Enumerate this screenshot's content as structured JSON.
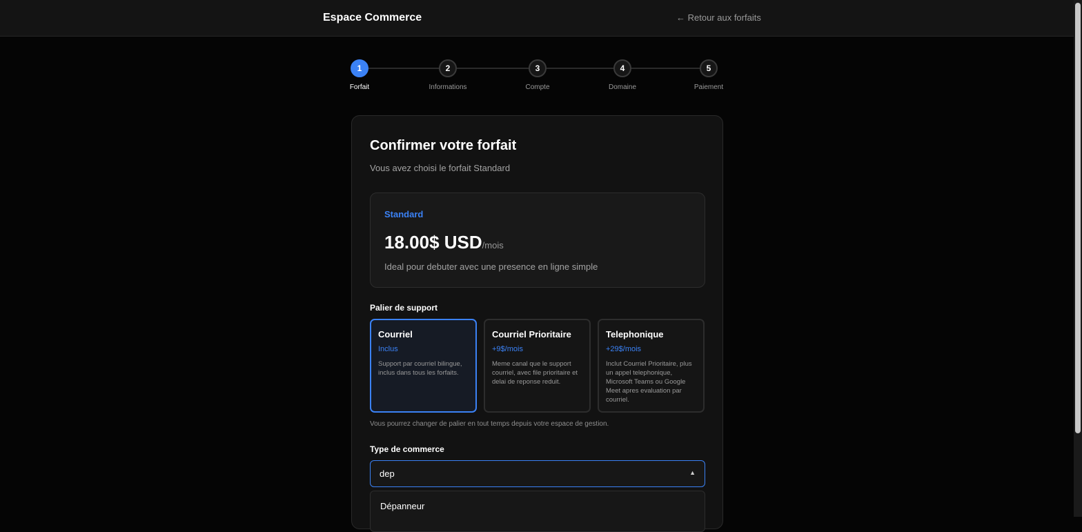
{
  "header": {
    "brand": "Espace Commerce",
    "back_link": "← Retour aux forfaits"
  },
  "stepper": {
    "steps": [
      {
        "number": "1",
        "label": "Forfait",
        "active": true
      },
      {
        "number": "2",
        "label": "Informations",
        "active": false
      },
      {
        "number": "3",
        "label": "Compte",
        "active": false
      },
      {
        "number": "4",
        "label": "Domaine",
        "active": false
      },
      {
        "number": "5",
        "label": "Paiement",
        "active": false
      }
    ]
  },
  "card": {
    "title": "Confirmer votre forfait",
    "subtitle": "Vous avez choisi le forfait Standard"
  },
  "plan": {
    "name": "Standard",
    "price": "18.00$ USD",
    "period": "/mois",
    "description": "Ideal pour debuter avec une presence en ligne simple"
  },
  "support": {
    "label": "Palier de support",
    "tiers": [
      {
        "name": "Courriel",
        "price": "Inclus",
        "description": "Support par courriel bilingue, inclus dans tous les forfaits.",
        "selected": true
      },
      {
        "name": "Courriel Prioritaire",
        "price": "+9$/mois",
        "description": "Meme canal que le support courriel, avec file prioritaire et delai de reponse reduit.",
        "selected": false
      },
      {
        "name": "Telephonique",
        "price": "+29$/mois",
        "description": "Inclut Courriel Prioritaire, plus un appel telephonique, Microsoft Teams ou Google Meet apres evaluation par courriel.",
        "selected": false
      }
    ],
    "helper": "Vous pourrez changer de palier en tout temps depuis votre espace de gestion."
  },
  "business_type": {
    "label": "Type de commerce",
    "value": "dep",
    "options": [
      "Dépanneur"
    ]
  },
  "colors": {
    "accent": "#3b82f6",
    "background": "#050505",
    "card": "#121212"
  },
  "icons": {
    "combo_caret": "caret-up-icon"
  }
}
